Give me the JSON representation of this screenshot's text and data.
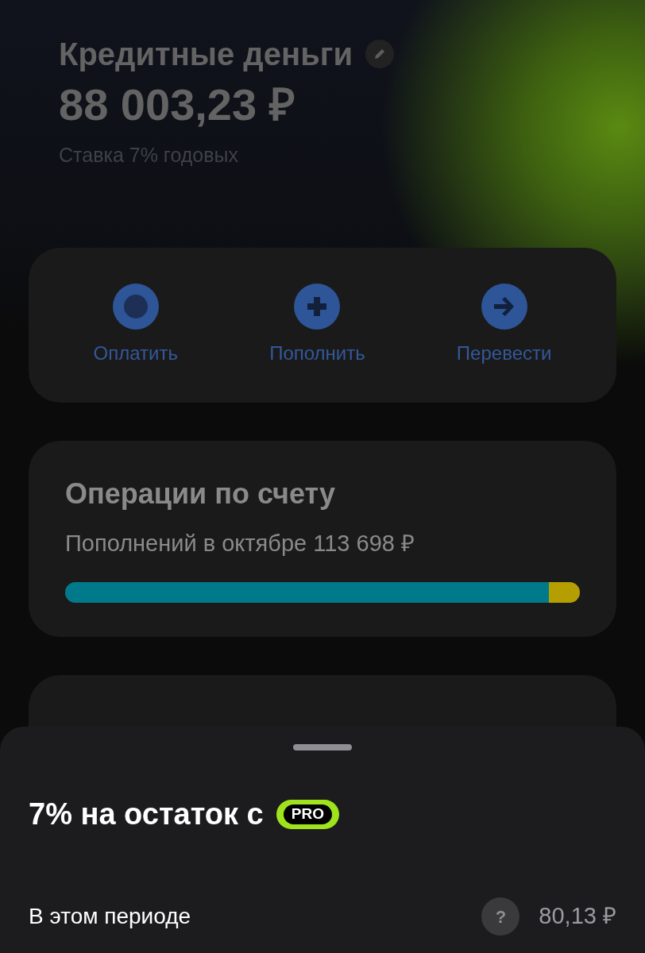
{
  "account": {
    "title": "Кредитные деньги",
    "balance": "88 003,23 ₽",
    "rate": "Ставка 7% годовых"
  },
  "actions": [
    {
      "kind": "pay",
      "label": "Оплатить"
    },
    {
      "kind": "topup",
      "label": "Пополнить"
    },
    {
      "kind": "transfer",
      "label": "Перевести"
    }
  ],
  "operations": {
    "title": "Операции по счету",
    "summary": "Пополнений в октябре 113 698 ₽",
    "segments": [
      {
        "level": 0.94,
        "color": "#007a8a"
      },
      {
        "level": 0.06,
        "color": "#b59f00"
      }
    ]
  },
  "sheet": {
    "title": "7% на остаток с",
    "badge": "PRO",
    "row": {
      "label": "В этом периоде",
      "help": "?",
      "value": "80,13 ₽"
    }
  }
}
